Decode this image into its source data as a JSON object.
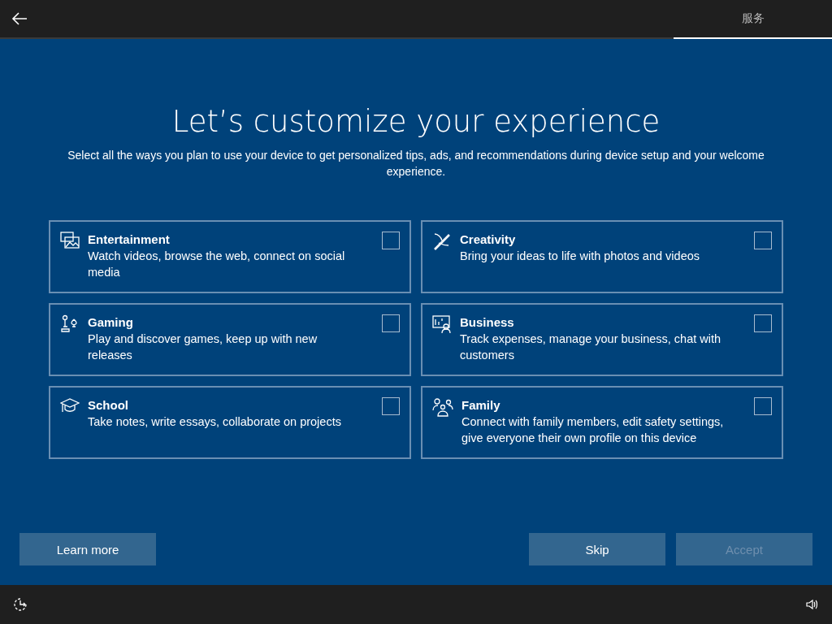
{
  "top_bar": {
    "tabs": [
      {
        "label": "服务",
        "selected": true
      }
    ]
  },
  "title": "Let’s customize your experience",
  "subtitle": "Select all the ways you plan to use your device to get personalized tips, ads, and recommendations during device setup and your welcome experience.",
  "options": [
    {
      "title": "Entertainment",
      "description": "Watch videos, browse the web, connect on social media",
      "checked": false
    },
    {
      "title": "Creativity",
      "description": "Bring your ideas to life with photos and videos",
      "checked": false
    },
    {
      "title": "Gaming",
      "description": "Play and discover games, keep up with new releases",
      "checked": false
    },
    {
      "title": "Business",
      "description": "Track expenses, manage your business, chat with customers",
      "checked": false
    },
    {
      "title": "School",
      "description": "Take notes, write essays, collaborate on projects",
      "checked": false
    },
    {
      "title": "Family",
      "description": "Connect with family members, edit safety settings, give everyone their own profile on this device",
      "checked": false
    }
  ],
  "buttons": [
    {
      "label": "Learn more",
      "disabled": false
    },
    {
      "label": "Skip",
      "disabled": false
    },
    {
      "label": "Accept",
      "disabled": true
    }
  ]
}
